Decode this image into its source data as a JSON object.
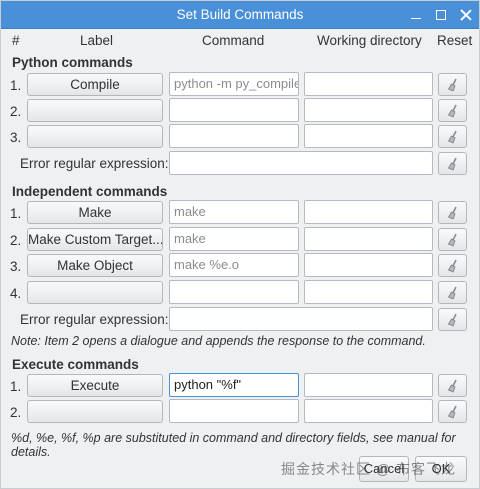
{
  "window": {
    "title": "Set Build Commands"
  },
  "headers": {
    "num": "#",
    "label": "Label",
    "command": "Command",
    "workdir": "Working directory",
    "reset": "Reset"
  },
  "python": {
    "title": "Python commands",
    "rows": [
      {
        "num": "1.",
        "label": "Compile",
        "command": "python -m py_compile",
        "workdir": ""
      },
      {
        "num": "2.",
        "label": "",
        "command": "",
        "workdir": ""
      },
      {
        "num": "3.",
        "label": "",
        "command": "",
        "workdir": ""
      }
    ],
    "error_label": "Error regular expression:",
    "error_value": ""
  },
  "independent": {
    "title": "Independent commands",
    "rows": [
      {
        "num": "1.",
        "label": "Make",
        "command": "make",
        "workdir": ""
      },
      {
        "num": "2.",
        "label": "Make Custom Target...",
        "command": "make",
        "workdir": ""
      },
      {
        "num": "3.",
        "label": "Make Object",
        "command": "make %e.o",
        "workdir": ""
      },
      {
        "num": "4.",
        "label": "",
        "command": "",
        "workdir": ""
      }
    ],
    "error_label": "Error regular expression:",
    "error_value": ""
  },
  "note": "Note: Item 2 opens a dialogue and appends the response to the command.",
  "execute": {
    "title": "Execute commands",
    "rows": [
      {
        "num": "1.",
        "label": "Execute",
        "command": "python \"%f\"",
        "workdir": ""
      },
      {
        "num": "2.",
        "label": "",
        "command": "",
        "workdir": ""
      }
    ]
  },
  "footnote": "%d, %e, %f, %p are substituted in command and directory fields, see manual for details.",
  "footer": {
    "cancel_label": "Cancel",
    "ok_label": "OK"
  },
  "watermark": "掘金技术社区 @ 布客飞龙",
  "icons": {
    "clear": "broom-icon",
    "minimize": "minimize-icon",
    "maximize": "maximize-icon",
    "close": "close-icon"
  }
}
